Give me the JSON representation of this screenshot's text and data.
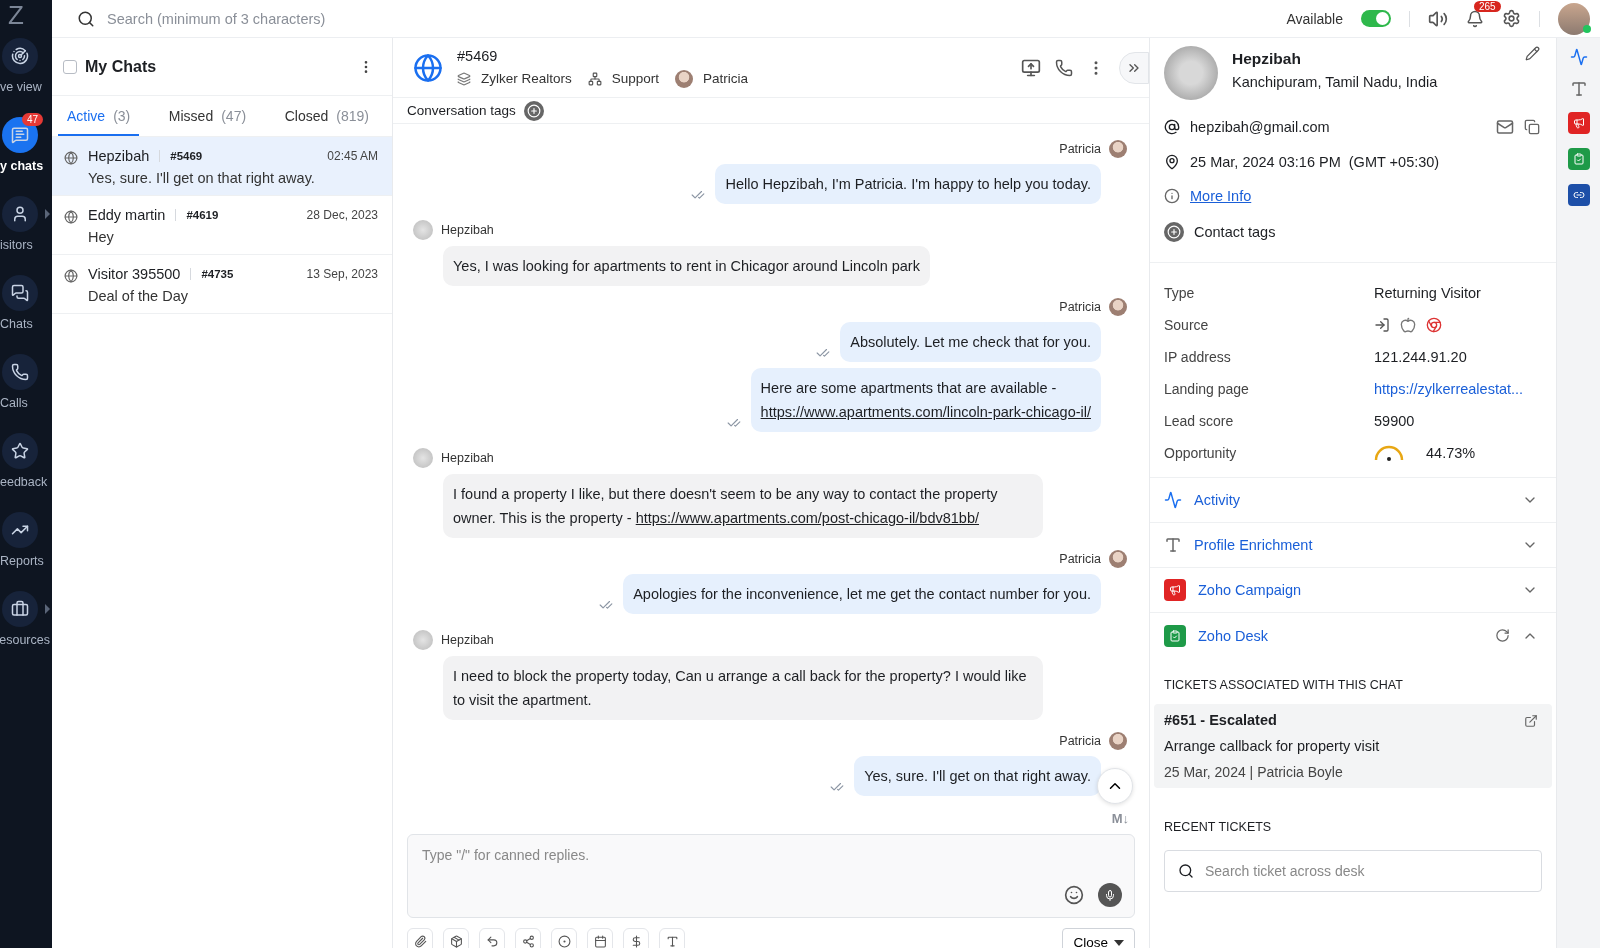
{
  "nav": {
    "logo": "Z",
    "items": [
      {
        "label": "ve view",
        "selected": false,
        "arrow": false
      },
      {
        "label": "y chats",
        "selected": true,
        "badge": "47",
        "arrow": false
      },
      {
        "label": "isitors",
        "selected": false,
        "arrow": true
      },
      {
        "label": "Chats",
        "selected": false,
        "arrow": false
      },
      {
        "label": "Calls",
        "selected": false,
        "arrow": false
      },
      {
        "label": "eedback",
        "selected": false,
        "arrow": false
      },
      {
        "label": "Reports",
        "selected": false,
        "arrow": false
      },
      {
        "label": "esources",
        "selected": false,
        "arrow": true
      }
    ]
  },
  "topbar": {
    "search_placeholder": "Search (minimum of 3 characters)",
    "status": {
      "label": "Available",
      "on": true
    },
    "notifications": "265"
  },
  "chat_list": {
    "title": "My Chats",
    "checked": false,
    "tabs": [
      {
        "label": "Active",
        "count": "(3)",
        "selected": true
      },
      {
        "label": "Missed",
        "count": "(47)",
        "selected": false
      },
      {
        "label": "Closed",
        "count": "(819)",
        "selected": false
      }
    ],
    "chats": [
      {
        "name": "Hepzibah",
        "id": "#5469",
        "time": "02:45 AM",
        "preview": "Yes, sure. I'll get on that right away.",
        "selected": true
      },
      {
        "name": "Eddy martin",
        "id": "#4619",
        "time": "28 Dec, 2023",
        "preview": "Hey",
        "selected": false
      },
      {
        "name": "Visitor 395500",
        "id": "#4735",
        "time": "13 Sep, 2023",
        "preview": "Deal of the Day",
        "selected": false
      }
    ]
  },
  "conversation": {
    "id": "#5469",
    "brand": "Zylker Realtors",
    "department": "Support",
    "agent": "Patricia",
    "tags_label": "Conversation tags",
    "messages": [
      {
        "kind": "agent",
        "sender": "Patricia",
        "text": "Hello Hepzibah, I'm Patricia. I'm happy to help you today."
      },
      {
        "kind": "visitor",
        "sender": "Hepzibah",
        "text": "Yes, I was looking for apartments to rent in Chicagor around Lincoln park"
      },
      {
        "kind": "agent",
        "sender": "Patricia",
        "text": "Absolutely. Let me check that for you."
      },
      {
        "kind": "agent",
        "text": "Here are some apartments that are available -",
        "link": "https://www.apartments.com/lincoln-park-chicago-il/"
      },
      {
        "kind": "visitor",
        "sender": "Hepzibah",
        "text": "I found a property I like, but there doesn't seem to be any way to contact the property owner. This is the property -",
        "link": "https://www.apartments.com/post-chicago-il/bdv81bb/"
      },
      {
        "kind": "agent",
        "sender": "Patricia",
        "text": "Apologies for the inconvenience, let me get the contact number for you."
      },
      {
        "kind": "visitor",
        "sender": "Hepzibah",
        "text": "I need to block the property today, Can u arrange a call back for the property? I would like to visit the apartment."
      },
      {
        "kind": "agent",
        "sender": "Patricia",
        "text": "Yes, sure. I'll get on that right away."
      }
    ],
    "markdown": "M↓",
    "composer": {
      "placeholder": "Type \"/\" for canned replies."
    },
    "close_button": "Close"
  },
  "visitor": {
    "name": "Hepzibah",
    "location": "Kanchipuram, Tamil Nadu, India",
    "email": "hepzibah@gmail.com",
    "local_time": "25 Mar, 2024 03:16 PM  (GMT +05:30)",
    "more_info": "More Info",
    "contact_tags": "Contact tags",
    "details": [
      {
        "kind": "text",
        "label": "Type",
        "value": "Returning Visitor"
      },
      {
        "kind": "source",
        "label": "Source"
      },
      {
        "kind": "text",
        "label": "IP address",
        "value": "121.244.91.20"
      },
      {
        "kind": "link",
        "label": "Landing page",
        "value": "https://zylkerrealestat..."
      },
      {
        "kind": "text",
        "label": "Lead score",
        "value": "59900"
      },
      {
        "kind": "gauge",
        "label": "Opportunity",
        "value": "44.73%"
      }
    ],
    "sections": [
      {
        "kind": "activity",
        "title": "Activity",
        "expanded": false
      },
      {
        "kind": "enrichment",
        "title": "Profile Enrichment",
        "expanded": false
      },
      {
        "kind": "campaign",
        "title": "Zoho Campaign",
        "expanded": false
      },
      {
        "kind": "desk",
        "title": "Zoho Desk",
        "expanded": true
      }
    ],
    "tickets_heading": "TICKETS ASSOCIATED WITH THIS CHAT",
    "tickets": [
      {
        "title": "#651 - Escalated",
        "subject": "Arrange callback for property visit",
        "meta": "25 Mar, 2024 | Patricia Boyle"
      }
    ],
    "recent_heading": "RECENT TICKETS",
    "ticket_search_placeholder": "Search ticket across desk"
  }
}
